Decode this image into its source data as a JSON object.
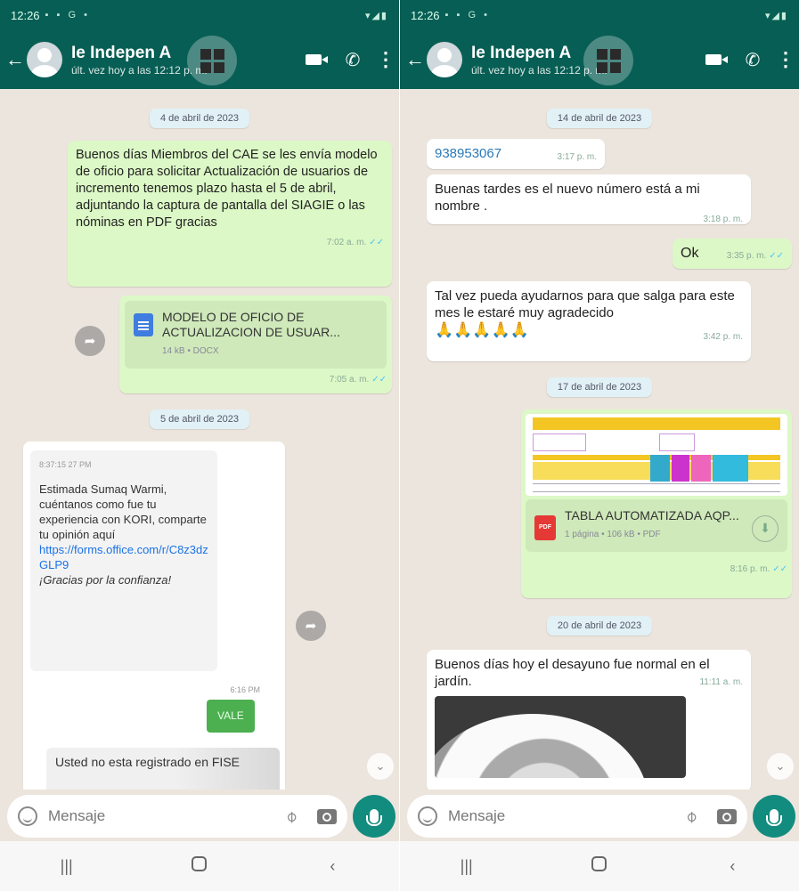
{
  "left": {
    "status": {
      "time": "12:26",
      "icons": "▪ ▪ G •",
      "right": "▾◢▮"
    },
    "header": {
      "title": "Ie Indepen A",
      "subtitle": "últ. vez hoy a las 12:12 p. m."
    },
    "chat": {
      "date1": "4 de abril de 2023",
      "msg1": {
        "text": "Buenos días Miembros del CAE se les envía modelo de oficio para solicitar Actualización de usuarios de incremento tenemos plazo hasta el 5 de abril, adjuntando la captura de pantalla del SIAGIE o las nóminas en PDF gracias",
        "time": "7:02 a. m."
      },
      "doc1": {
        "name": "MODELO DE OFICIO DE ACTUALIZACION DE USUAR...",
        "info": "14 kB • DOCX",
        "time": "7:05 a. m."
      },
      "date2": "5 de abril de 2023",
      "msg2": {
        "header": "8:37:15 27 PM",
        "text1": "Estimada Sumaq Warmi, cuéntanos como fue tu experiencia con KORI, comparte tu opinión aquí",
        "link": "https://forms.office.com/r/C8z3dzGLP9",
        "text2": "¡Gracias por la confianza!",
        "time2": "6:16 PM",
        "button": "VALE",
        "text3": "Usted no esta registrado en FISE"
      }
    },
    "input": {
      "placeholder": "Mensaje"
    }
  },
  "right": {
    "status": {
      "time": "12:26",
      "icons": "▪ ▪ G •",
      "right": "▾◢▮"
    },
    "header": {
      "title": "Ie Indepen A",
      "subtitle": "últ. vez hoy a las 12:12 p. m."
    },
    "chat": {
      "date1": "14 de abril de 2023",
      "phone": {
        "text": "938953067",
        "time": "3:17 p. m."
      },
      "msg1": {
        "text": "Buenas tardes es el nuevo número está a mi nombre .",
        "time": "3:18 p. m."
      },
      "ok": {
        "text": "Ok",
        "time": "3:35 p. m."
      },
      "msg2": {
        "text": "Tal vez pueda ayudarnos para que salga para este mes le estaré muy agradecido",
        "emoji": "🙏🙏🙏🙏🙏",
        "time": "3:42 p. m."
      },
      "date2": "17 de abril de 2023",
      "pdf": {
        "name": "TABLA AUTOMATIZADA AQP...",
        "info": "1 página • 106 kB • PDF",
        "time": "8:16 p. m."
      },
      "date3": "20 de abril de 2023",
      "msg3": {
        "text": "Buenos días hoy el desayuno fue normal en el jardín.",
        "time": "11:11 a. m."
      }
    },
    "input": {
      "placeholder": "Mensaje"
    }
  },
  "colors": {
    "header": "#075e54",
    "outgoing": "#dcf8c6",
    "incoming": "#ffffff",
    "wallpaper": "#ece5dd",
    "accent": "#128c7e"
  },
  "icons": [
    "back-arrow-icon",
    "avatar",
    "video-call-icon",
    "phone-icon",
    "more-icon",
    "emoji-icon",
    "attach-icon",
    "camera-icon",
    "mic-icon",
    "forward-icon",
    "scroll-down-icon"
  ]
}
